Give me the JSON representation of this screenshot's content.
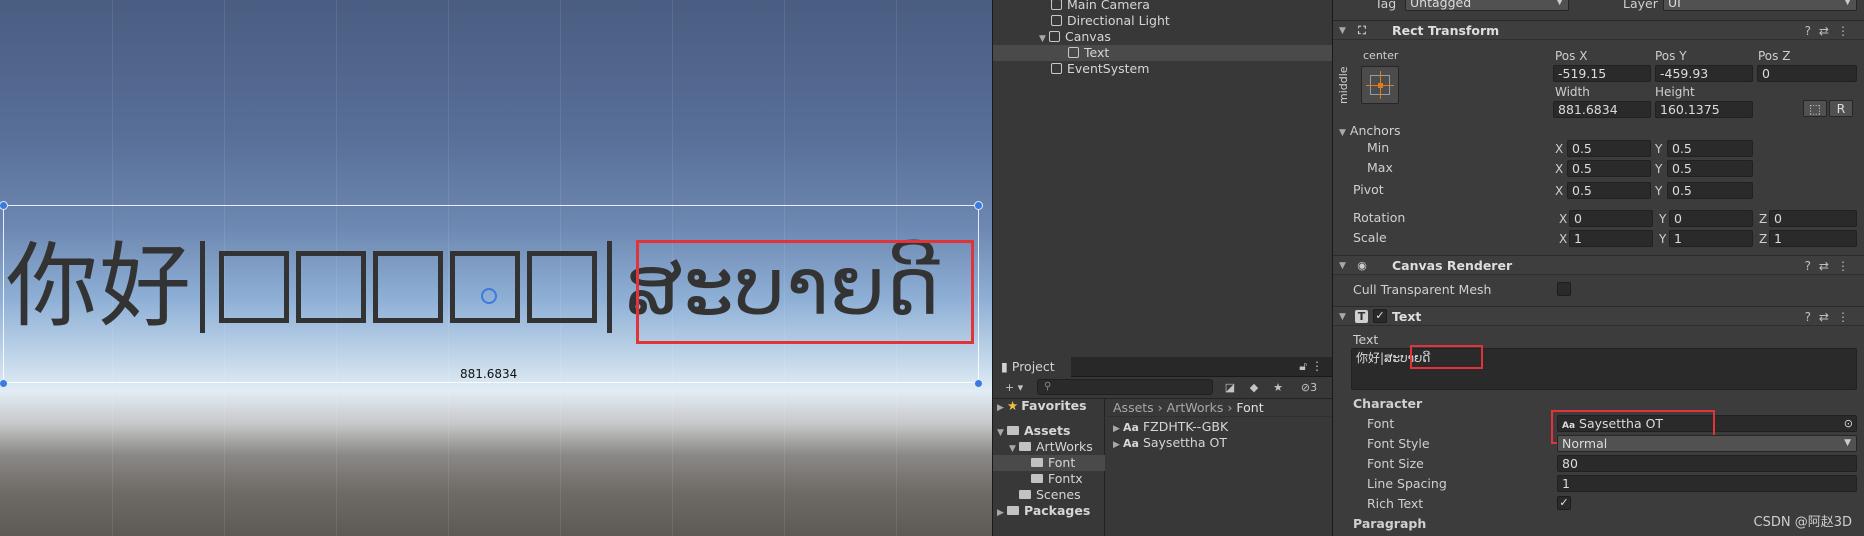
{
  "scene": {
    "text_cjk": "你好",
    "text_lao": "ສະບາຍດີ",
    "width_label": "881.6834"
  },
  "hierarchy": {
    "items": [
      {
        "label": "Main Camera"
      },
      {
        "label": "Directional Light"
      },
      {
        "label": "Canvas"
      },
      {
        "label": "Text"
      },
      {
        "label": "EventSystem"
      }
    ]
  },
  "project": {
    "tab_label": "Project",
    "add_label": "+ ▾",
    "search_placeholder": "",
    "hidden_count": "3",
    "tree": {
      "favorites": "Favorites",
      "assets": "Assets",
      "artworks": "ArtWorks",
      "font": "Font",
      "fontx": "Fontx",
      "scenes": "Scenes",
      "packages": "Packages"
    },
    "breadcrumb": [
      "Assets",
      "ArtWorks",
      "Font"
    ],
    "files": [
      {
        "label": "FZDHTK--GBK"
      },
      {
        "label": "Saysettha OT"
      }
    ]
  },
  "inspector": {
    "tag_label": "Tag",
    "tag_value": "Untagged",
    "layer_label": "Layer",
    "layer_value": "UI",
    "rect_transform": {
      "title": "Rect Transform",
      "center_label": "center",
      "middle_label": "middle",
      "posx_label": "Pos X",
      "posy_label": "Pos Y",
      "posz_label": "Pos Z",
      "posx": "-519.15",
      "posy": "-459.93",
      "posz": "0",
      "width_label": "Width",
      "height_label": "Height",
      "width": "881.6834",
      "height": "160.1375",
      "r_label": "R",
      "anchors_label": "Anchors",
      "min_label": "Min",
      "max_label": "Max",
      "pivot_label": "Pivot",
      "min_x": "0.5",
      "min_y": "0.5",
      "max_x": "0.5",
      "max_y": "0.5",
      "pivot_x": "0.5",
      "pivot_y": "0.5",
      "rotation_label": "Rotation",
      "scale_label": "Scale",
      "rot_x": "0",
      "rot_y": "0",
      "rot_z": "0",
      "scale_x": "1",
      "scale_y": "1",
      "scale_z": "1",
      "x": "X",
      "y": "Y",
      "z": "Z"
    },
    "canvas_renderer": {
      "title": "Canvas Renderer",
      "cull_label": "Cull Transparent Mesh"
    },
    "text_component": {
      "title": "Text",
      "text_label": "Text",
      "text_value": "你好|ສະບາຍດີ",
      "character_label": "Character",
      "font_label": "Font",
      "font_value": "Saysettha OT",
      "font_style_label": "Font Style",
      "font_style_value": "Normal",
      "font_size_label": "Font Size",
      "font_size_value": "80",
      "line_spacing_label": "Line Spacing",
      "line_spacing_value": "1",
      "rich_text_label": "Rich Text",
      "paragraph_label": "Paragraph"
    },
    "watermark": "CSDN @阿赵3D"
  },
  "colors": {
    "highlight_red": "#e0333a",
    "selection_blue": "#3b7bdc"
  }
}
